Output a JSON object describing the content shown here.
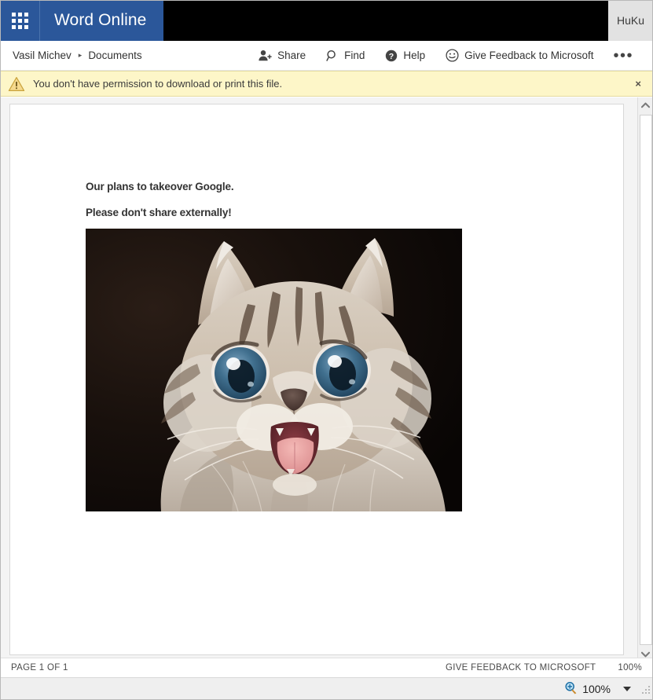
{
  "suite": {
    "app_launcher_icon": "waffle-grid-icon",
    "brand": "Word Online",
    "me_initials": "HuKu"
  },
  "command_bar": {
    "breadcrumb": {
      "root": "Vasil Michev",
      "separator": "▸",
      "current": "Documents"
    },
    "items": [
      {
        "label": "Share",
        "icon": "share-person-icon"
      },
      {
        "label": "Find",
        "icon": "magnifier-icon"
      },
      {
        "label": "Help",
        "icon": "question-circle-icon"
      },
      {
        "label": "Give Feedback to Microsoft",
        "icon": "smiley-icon"
      }
    ],
    "overflow_label": "•••"
  },
  "notification": {
    "icon": "warning-triangle-icon",
    "message": "You don't have permission to download or print this file.",
    "close_label": "×",
    "background": "#fdf6c8",
    "border": "#e4daa0"
  },
  "document": {
    "lines": [
      "Our plans to takeover Google.",
      "Please don't share externally!"
    ],
    "image_alt": "Photo of a smiling tabby kitten with wide blue eyes and open mouth"
  },
  "scrollbar": {
    "up_icon": "chevron-up-icon",
    "down_icon": "chevron-down-icon"
  },
  "status_bar": {
    "page_indicator": "PAGE 1 OF 1",
    "feedback": "GIVE FEEDBACK TO MICROSOFT",
    "zoom_text": "100%"
  },
  "zoom_bar": {
    "icon": "zoom-magnifier-icon",
    "level": "100%",
    "caret_icon": "chevron-down-icon",
    "grip_icon": "resize-grip-icon"
  },
  "colors": {
    "brand_blue": "#2b579a",
    "suite_black": "#000000",
    "me_bg": "#e2e2e2",
    "notify_yellow": "#fdf6c8",
    "canvas_gray": "#f4f4f4"
  }
}
